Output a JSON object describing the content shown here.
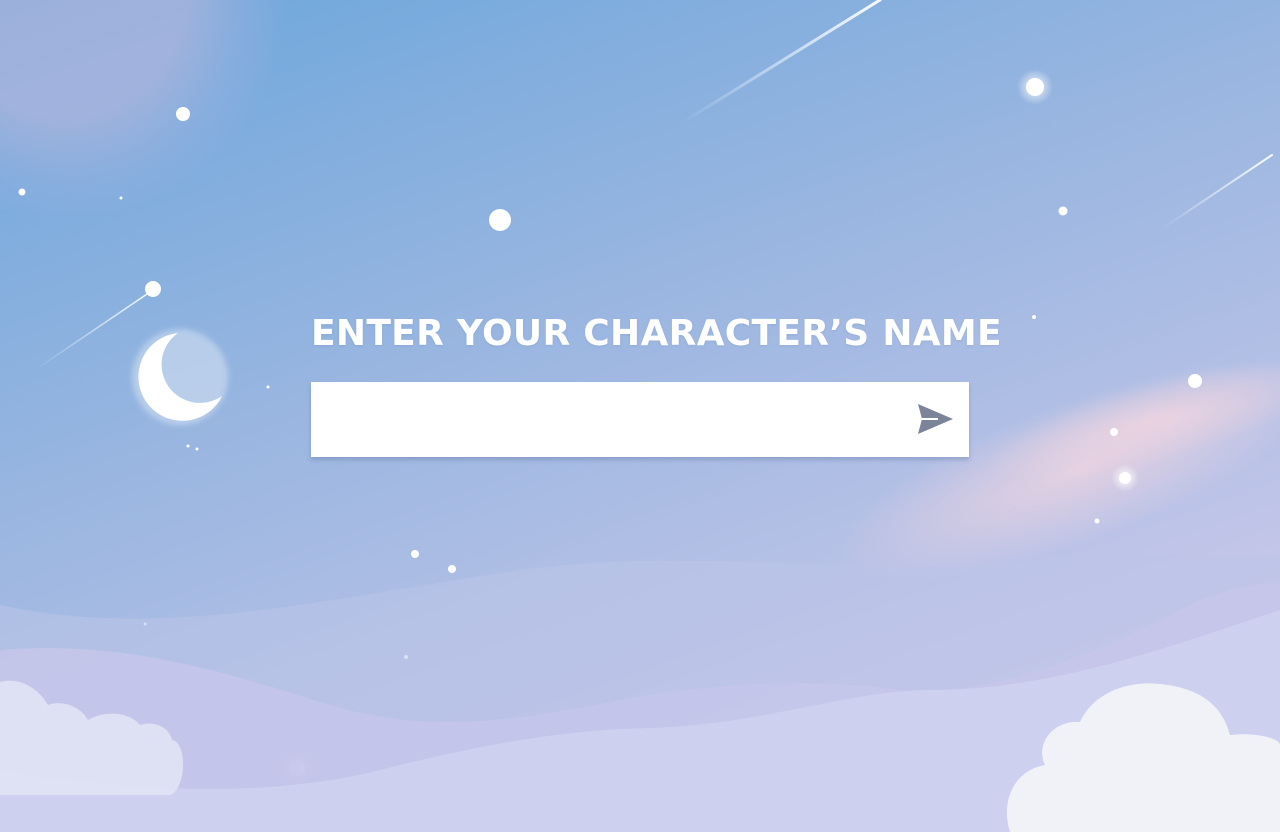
{
  "prompt": {
    "title": "ENTER YOUR CHARACTER’S NAME"
  },
  "name_input": {
    "value": "",
    "placeholder": ""
  },
  "submit_button": {
    "icon": "send-icon",
    "color": "#7b8499"
  },
  "background": {
    "sky_top": "#6fa7dc",
    "sky_bottom": "#c4c8ea",
    "hill_color": "#cdd0ef",
    "cloud_color": "#f1f3f9",
    "star_color": "#ffffff",
    "moon_icon": "moon-icon",
    "decor_icons": [
      "star-icon",
      "shooting-star-icon",
      "cloud-icon"
    ]
  }
}
